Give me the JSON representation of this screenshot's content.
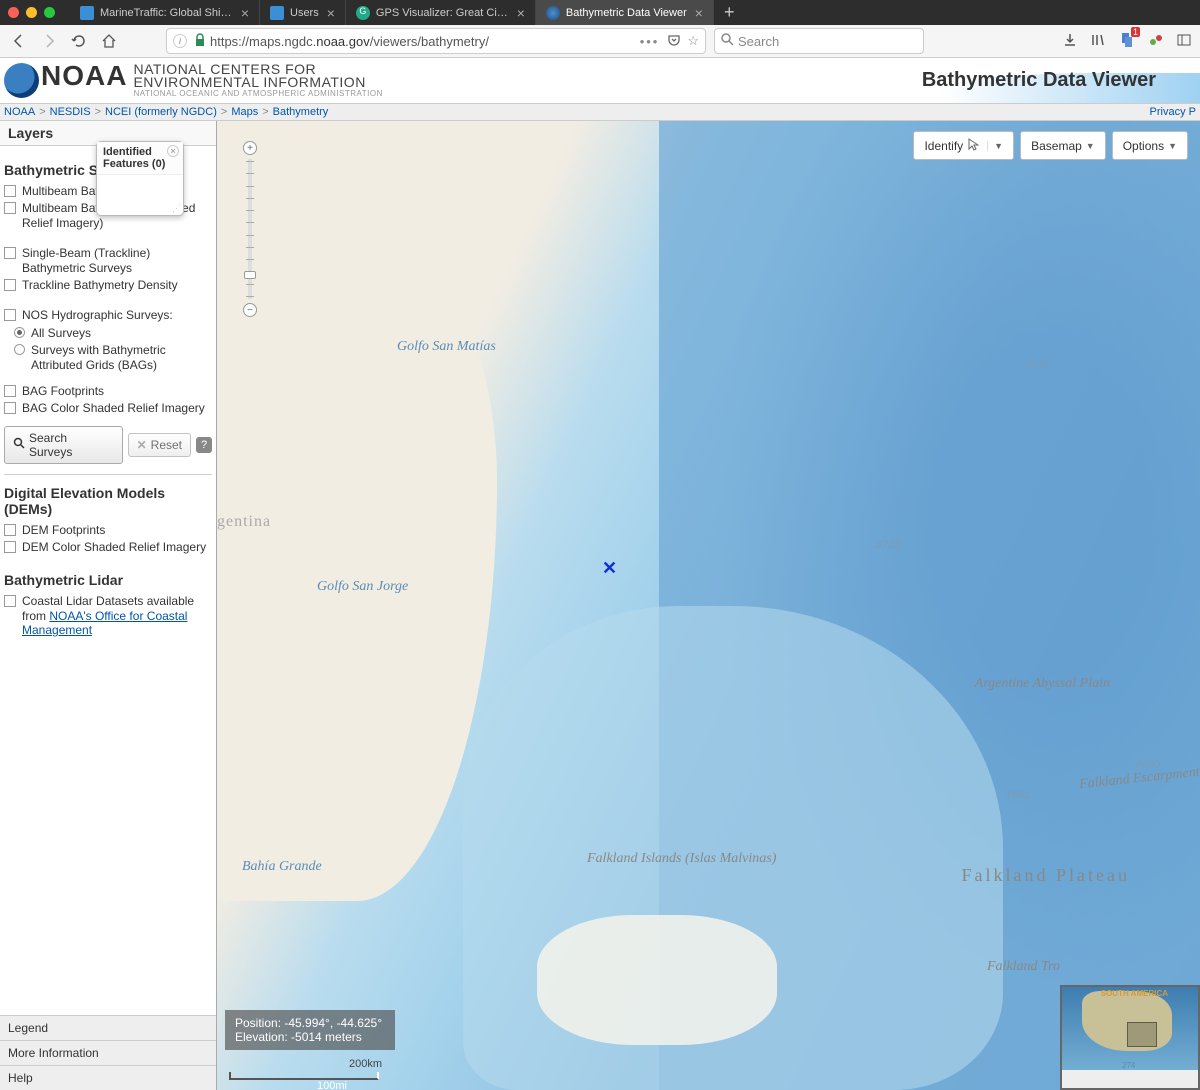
{
  "browser": {
    "tabs": [
      {
        "title": "MarineTraffic: Global Ship Trac",
        "icon_color": "#3a8fd6"
      },
      {
        "title": "Users",
        "icon_color": "#3a8fd6"
      },
      {
        "title": "GPS Visualizer: Great Circle Dis",
        "icon_color": "#2a8"
      },
      {
        "title": "Bathymetric Data Viewer",
        "icon_color": "#2c5aa0",
        "active": true
      }
    ],
    "url_prefix": "https://maps.ngdc.",
    "url_domain": "noaa.gov",
    "url_path": "/viewers/bathymetry/",
    "search_placeholder": "Search",
    "notification_count": "1"
  },
  "header": {
    "noaa": "NOAA",
    "line1": "NATIONAL CENTERS FOR",
    "line2": "ENVIRONMENTAL INFORMATION",
    "line3": "NATIONAL OCEANIC AND ATMOSPHERIC ADMINISTRATION",
    "viewer_title": "Bathymetric Data Viewer"
  },
  "breadcrumb": {
    "items": [
      "NOAA",
      "NESDIS",
      "NCEI (formerly NGDC)",
      "Maps",
      "Bathymetry"
    ],
    "privacy": "Privacy P"
  },
  "sidebar": {
    "title": "Layers",
    "sections": {
      "surveys": {
        "head": "Bathymetric Su",
        "multibeam": "Multibeam Bath",
        "multibeam_shaded": "Multibeam Bath                     ded Relief Imagery)",
        "single_beam": "Single-Beam (Trackline) Bathymetric Surveys",
        "trackline": "Trackline Bathymetry Density",
        "nos": "NOS Hydrographic Surveys:",
        "all_surveys": "All Surveys",
        "bags": "Surveys with Bathymetric Attributed Grids (BAGs)",
        "bag_foot": "BAG Footprints",
        "bag_color": "BAG Color Shaded Relief Imagery"
      },
      "buttons": {
        "search": "Search Surveys",
        "reset": "Reset",
        "help": "?"
      },
      "dems": {
        "head": "Digital Elevation Models (DEMs)",
        "foot": "DEM Footprints",
        "color": "DEM Color Shaded Relief Imagery"
      },
      "lidar": {
        "head": "Bathymetric Lidar",
        "coastal_pre": "Coastal Lidar Datasets available from ",
        "coastal_link": "NOAA's Office for Coastal Management"
      }
    },
    "bottom": {
      "legend": "Legend",
      "more": "More Information",
      "help": "Help"
    }
  },
  "popup": {
    "title_l1": "Identified",
    "title_l2": "Features (0)"
  },
  "map": {
    "labels": {
      "golfo_matias": "Golfo San Matías",
      "argentina": "gentina",
      "golfo_jorge": "Golfo San Jorge",
      "bahia_grande": "Bahía Grande",
      "falkland_islands": "Falkland Islands (Islas Malvinas)",
      "argentine_abyssal": "Argentine Abyssal Plain",
      "falkland_escarp": "Falkland Escarpment",
      "falkland_plateau": "Falkland Plateau",
      "falkland_trough": "Falkland Tro"
    },
    "depths": {
      "d1": "5349",
      "d2": "4541",
      "d3": "3713",
      "d4": "6690",
      "d5": "1661",
      "d6": "274"
    },
    "toolbar": {
      "identify": "Identify",
      "basemap": "Basemap",
      "options": "Options"
    },
    "status": {
      "position": "Position: -45.994°, -44.625°",
      "elevation": "Elevation: -5014 meters"
    },
    "scale": {
      "km": "200km",
      "mi": "100mi"
    },
    "overview": {
      "label": "SOUTH AMERICA"
    }
  }
}
